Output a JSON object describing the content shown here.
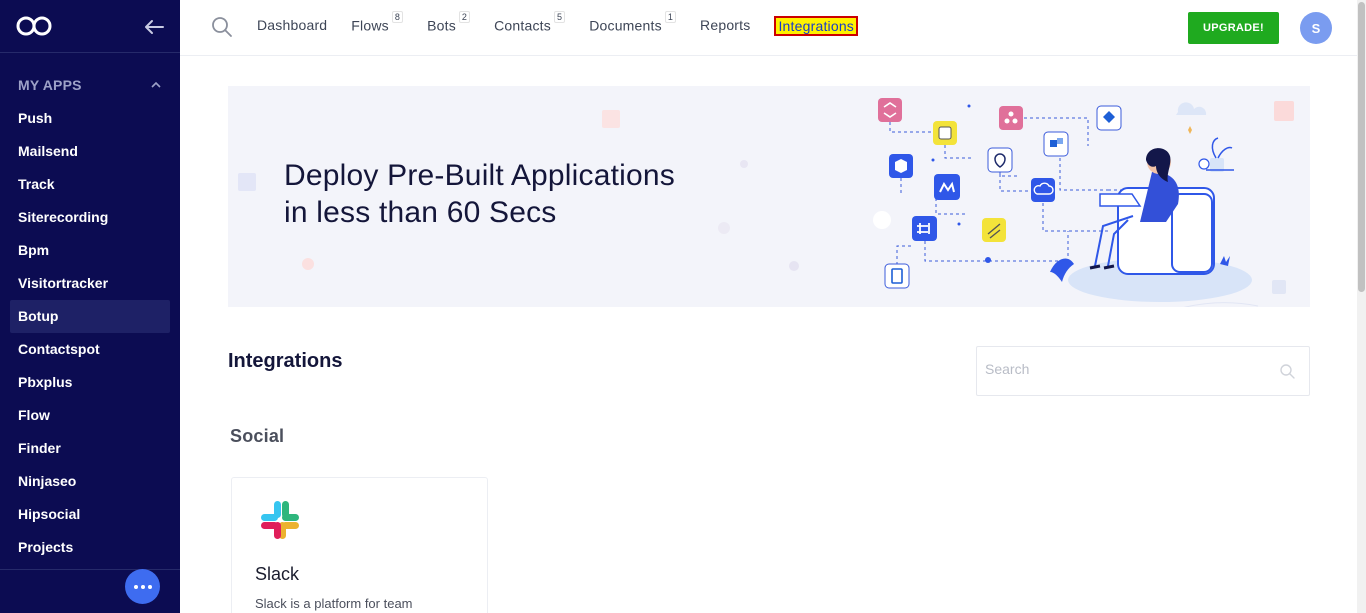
{
  "sidebar": {
    "section_title": "MY APPS",
    "items": [
      {
        "label": "Push",
        "active": false
      },
      {
        "label": "Mailsend",
        "active": false
      },
      {
        "label": "Track",
        "active": false
      },
      {
        "label": "Siterecording",
        "active": false
      },
      {
        "label": "Bpm",
        "active": false
      },
      {
        "label": "Visitortracker",
        "active": false
      },
      {
        "label": "Botup",
        "active": true
      },
      {
        "label": "Contactspot",
        "active": false
      },
      {
        "label": "Pbxplus",
        "active": false
      },
      {
        "label": "Flow",
        "active": false
      },
      {
        "label": "Finder",
        "active": false
      },
      {
        "label": "Ninjaseo",
        "active": false
      },
      {
        "label": "Hipsocial",
        "active": false
      },
      {
        "label": "Projects",
        "active": false
      }
    ]
  },
  "topnav": {
    "items": [
      {
        "label": "Dashboard",
        "badge": ""
      },
      {
        "label": "Flows",
        "badge": "8"
      },
      {
        "label": "Bots",
        "badge": "2"
      },
      {
        "label": "Contacts",
        "badge": "5"
      },
      {
        "label": "Documents",
        "badge": "1"
      },
      {
        "label": "Reports",
        "badge": ""
      },
      {
        "label": "Integrations",
        "badge": "",
        "highlighted": true
      }
    ],
    "upgrade_label": "UPGRADE!",
    "avatar_initial": "S"
  },
  "banner": {
    "title_line1": "Deploy Pre-Built Applications",
    "title_line2": "in less than 60 Secs"
  },
  "integrations": {
    "title": "Integrations",
    "search_placeholder": "Search",
    "category": "Social",
    "cards": [
      {
        "name": "Slack",
        "description": "Slack is a platform for team"
      }
    ]
  },
  "colors": {
    "sidebar_bg": "#0c0c52",
    "accent_blue": "#3e6cf0",
    "upgrade_green": "#1faa1f",
    "highlight_yellow": "#fff200",
    "highlight_border": "#cc0000"
  }
}
